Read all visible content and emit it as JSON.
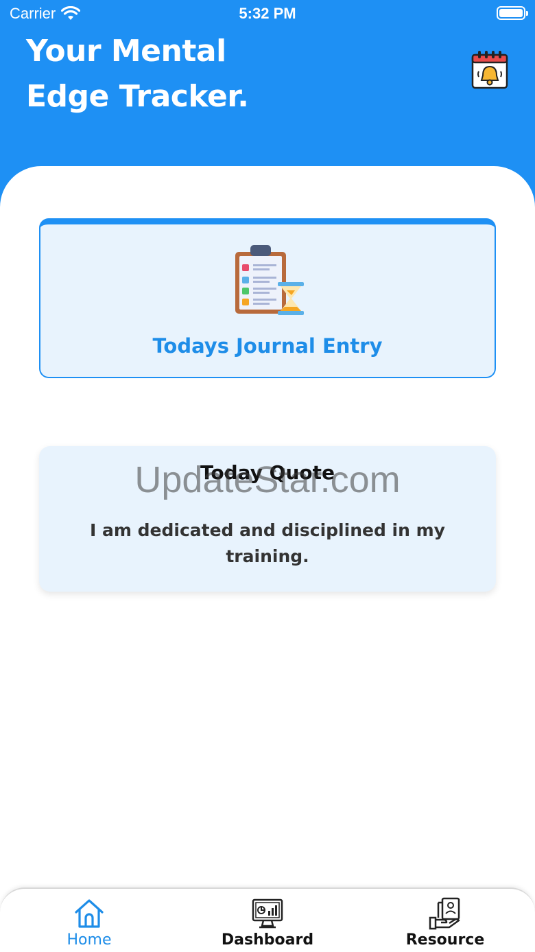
{
  "status": {
    "carrier": "Carrier",
    "time": "5:32 PM"
  },
  "header": {
    "title_line1": "Your Mental",
    "title_line2": "Edge Tracker.",
    "reminder_icon": "calendar-bell-icon"
  },
  "journal": {
    "label": "Todays Journal Entry",
    "icon": "clipboard-checklist-hourglass-icon"
  },
  "quote": {
    "title": "Today Quote",
    "text": "I am dedicated and disciplined in my training."
  },
  "watermark": "UpdateStar.com",
  "tabs": [
    {
      "label": "Home",
      "icon": "home-icon",
      "active": true
    },
    {
      "label": "Dashboard",
      "icon": "dashboard-monitor-icon",
      "active": false
    },
    {
      "label": "Resource",
      "icon": "resource-document-hand-icon",
      "active": false
    }
  ],
  "colors": {
    "primary": "#1e90f4",
    "card_bg": "#e8f3fd",
    "active_tab": "#1e8de8"
  }
}
